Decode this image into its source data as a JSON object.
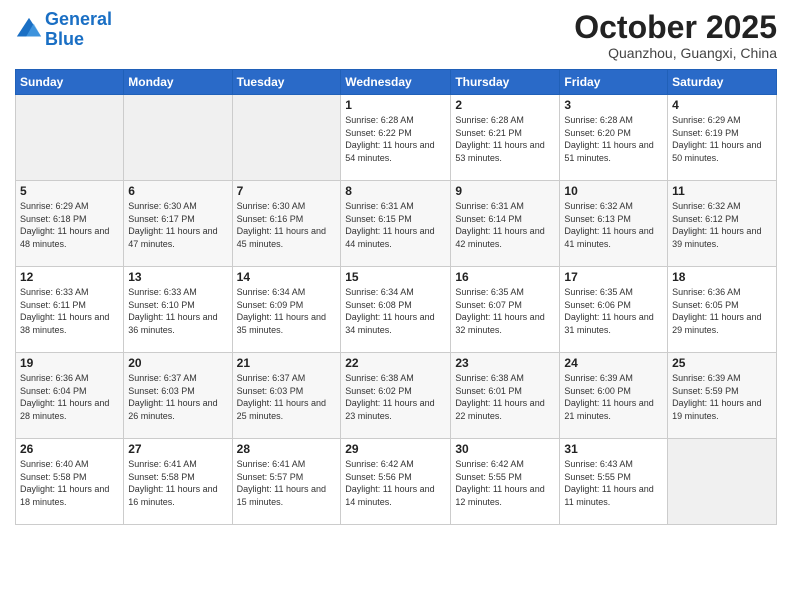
{
  "header": {
    "title": "October 2025",
    "subtitle": "Quanzhou, Guangxi, China"
  },
  "weekdays": [
    "Sunday",
    "Monday",
    "Tuesday",
    "Wednesday",
    "Thursday",
    "Friday",
    "Saturday"
  ],
  "days": [
    {
      "num": "",
      "sunrise": "",
      "sunset": "",
      "daylight": ""
    },
    {
      "num": "",
      "sunrise": "",
      "sunset": "",
      "daylight": ""
    },
    {
      "num": "",
      "sunrise": "",
      "sunset": "",
      "daylight": ""
    },
    {
      "num": "1",
      "sunrise": "6:28 AM",
      "sunset": "6:22 PM",
      "daylight": "11 hours and 54 minutes."
    },
    {
      "num": "2",
      "sunrise": "6:28 AM",
      "sunset": "6:21 PM",
      "daylight": "11 hours and 53 minutes."
    },
    {
      "num": "3",
      "sunrise": "6:28 AM",
      "sunset": "6:20 PM",
      "daylight": "11 hours and 51 minutes."
    },
    {
      "num": "4",
      "sunrise": "6:29 AM",
      "sunset": "6:19 PM",
      "daylight": "11 hours and 50 minutes."
    },
    {
      "num": "5",
      "sunrise": "6:29 AM",
      "sunset": "6:18 PM",
      "daylight": "11 hours and 48 minutes."
    },
    {
      "num": "6",
      "sunrise": "6:30 AM",
      "sunset": "6:17 PM",
      "daylight": "11 hours and 47 minutes."
    },
    {
      "num": "7",
      "sunrise": "6:30 AM",
      "sunset": "6:16 PM",
      "daylight": "11 hours and 45 minutes."
    },
    {
      "num": "8",
      "sunrise": "6:31 AM",
      "sunset": "6:15 PM",
      "daylight": "11 hours and 44 minutes."
    },
    {
      "num": "9",
      "sunrise": "6:31 AM",
      "sunset": "6:14 PM",
      "daylight": "11 hours and 42 minutes."
    },
    {
      "num": "10",
      "sunrise": "6:32 AM",
      "sunset": "6:13 PM",
      "daylight": "11 hours and 41 minutes."
    },
    {
      "num": "11",
      "sunrise": "6:32 AM",
      "sunset": "6:12 PM",
      "daylight": "11 hours and 39 minutes."
    },
    {
      "num": "12",
      "sunrise": "6:33 AM",
      "sunset": "6:11 PM",
      "daylight": "11 hours and 38 minutes."
    },
    {
      "num": "13",
      "sunrise": "6:33 AM",
      "sunset": "6:10 PM",
      "daylight": "11 hours and 36 minutes."
    },
    {
      "num": "14",
      "sunrise": "6:34 AM",
      "sunset": "6:09 PM",
      "daylight": "11 hours and 35 minutes."
    },
    {
      "num": "15",
      "sunrise": "6:34 AM",
      "sunset": "6:08 PM",
      "daylight": "11 hours and 34 minutes."
    },
    {
      "num": "16",
      "sunrise": "6:35 AM",
      "sunset": "6:07 PM",
      "daylight": "11 hours and 32 minutes."
    },
    {
      "num": "17",
      "sunrise": "6:35 AM",
      "sunset": "6:06 PM",
      "daylight": "11 hours and 31 minutes."
    },
    {
      "num": "18",
      "sunrise": "6:36 AM",
      "sunset": "6:05 PM",
      "daylight": "11 hours and 29 minutes."
    },
    {
      "num": "19",
      "sunrise": "6:36 AM",
      "sunset": "6:04 PM",
      "daylight": "11 hours and 28 minutes."
    },
    {
      "num": "20",
      "sunrise": "6:37 AM",
      "sunset": "6:03 PM",
      "daylight": "11 hours and 26 minutes."
    },
    {
      "num": "21",
      "sunrise": "6:37 AM",
      "sunset": "6:03 PM",
      "daylight": "11 hours and 25 minutes."
    },
    {
      "num": "22",
      "sunrise": "6:38 AM",
      "sunset": "6:02 PM",
      "daylight": "11 hours and 23 minutes."
    },
    {
      "num": "23",
      "sunrise": "6:38 AM",
      "sunset": "6:01 PM",
      "daylight": "11 hours and 22 minutes."
    },
    {
      "num": "24",
      "sunrise": "6:39 AM",
      "sunset": "6:00 PM",
      "daylight": "11 hours and 21 minutes."
    },
    {
      "num": "25",
      "sunrise": "6:39 AM",
      "sunset": "5:59 PM",
      "daylight": "11 hours and 19 minutes."
    },
    {
      "num": "26",
      "sunrise": "6:40 AM",
      "sunset": "5:58 PM",
      "daylight": "11 hours and 18 minutes."
    },
    {
      "num": "27",
      "sunrise": "6:41 AM",
      "sunset": "5:58 PM",
      "daylight": "11 hours and 16 minutes."
    },
    {
      "num": "28",
      "sunrise": "6:41 AM",
      "sunset": "5:57 PM",
      "daylight": "11 hours and 15 minutes."
    },
    {
      "num": "29",
      "sunrise": "6:42 AM",
      "sunset": "5:56 PM",
      "daylight": "11 hours and 14 minutes."
    },
    {
      "num": "30",
      "sunrise": "6:42 AM",
      "sunset": "5:55 PM",
      "daylight": "11 hours and 12 minutes."
    },
    {
      "num": "31",
      "sunrise": "6:43 AM",
      "sunset": "5:55 PM",
      "daylight": "11 hours and 11 minutes."
    },
    {
      "num": "",
      "sunrise": "",
      "sunset": "",
      "daylight": ""
    }
  ]
}
